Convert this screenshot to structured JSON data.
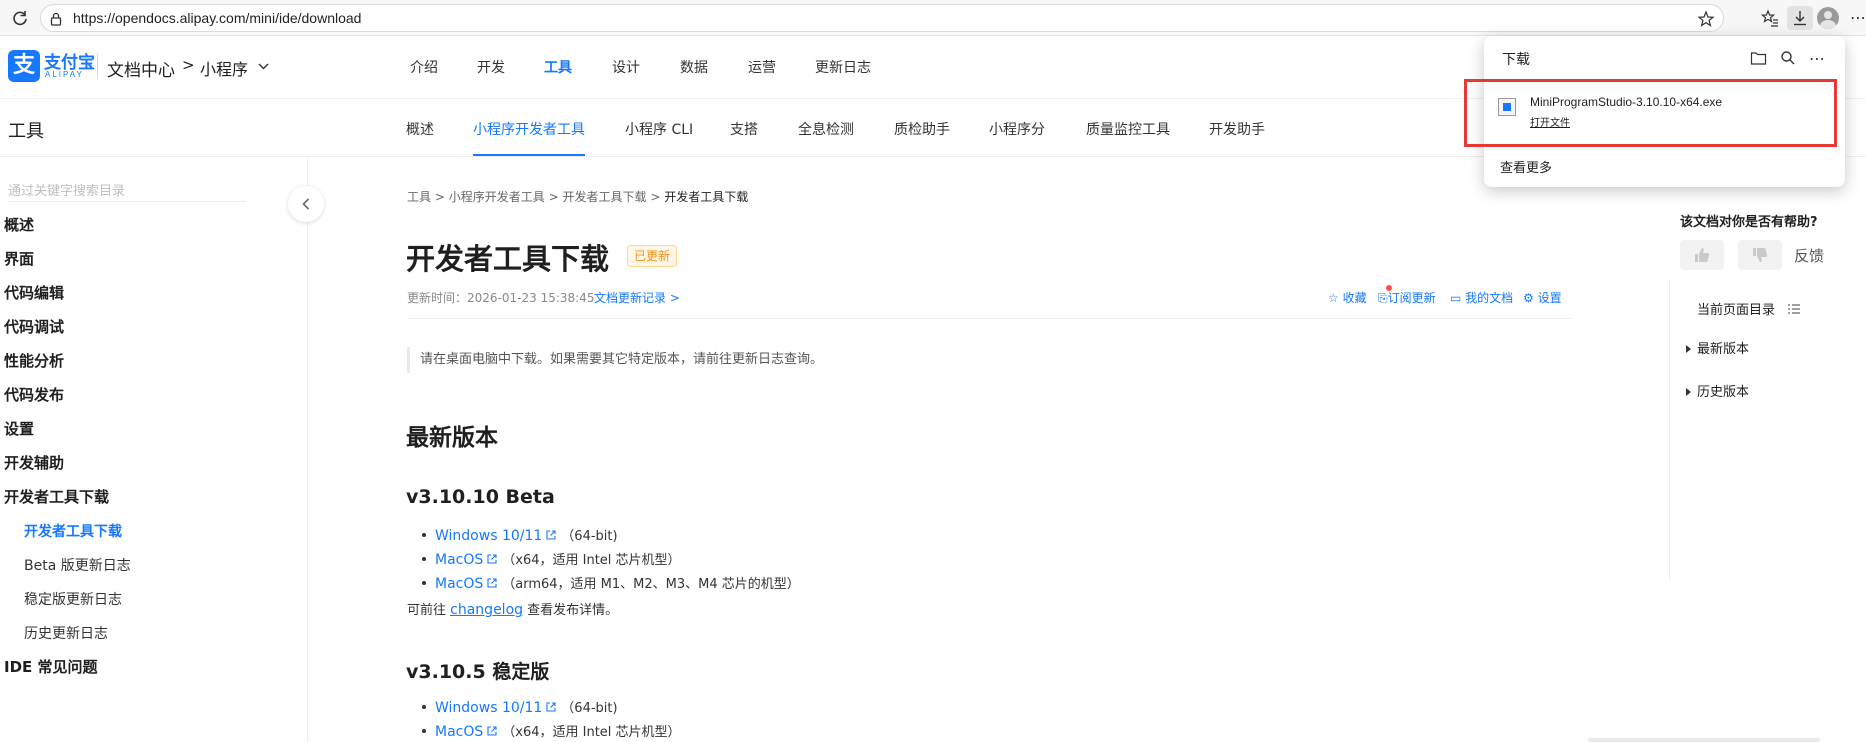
{
  "browser": {
    "url": "https://opendocs.alipay.com/mini/ide/download"
  },
  "header": {
    "logo_text": "支付宝",
    "logo_sub": "ALIPAY",
    "doc_center": "文档中心",
    "separator": ">",
    "product": "小程序",
    "tabs": [
      {
        "label": "介绍"
      },
      {
        "label": "开发"
      },
      {
        "label": "工具",
        "active": true
      },
      {
        "label": "设计"
      },
      {
        "label": "数据"
      },
      {
        "label": "运营"
      },
      {
        "label": "更新日志"
      }
    ]
  },
  "subnav": {
    "title": "工具",
    "tabs": [
      {
        "label": "概述"
      },
      {
        "label": "小程序开发者工具",
        "active": true
      },
      {
        "label": "小程序 CLI"
      },
      {
        "label": "支搭"
      },
      {
        "label": "全息检测"
      },
      {
        "label": "质检助手"
      },
      {
        "label": "小程序分"
      },
      {
        "label": "质量监控工具"
      },
      {
        "label": "开发助手"
      }
    ]
  },
  "sidebar": {
    "search_placeholder": "通过关键字搜索目录",
    "items": [
      {
        "label": "概述"
      },
      {
        "label": "界面"
      },
      {
        "label": "代码编辑"
      },
      {
        "label": "代码调试"
      },
      {
        "label": "性能分析"
      },
      {
        "label": "代码发布"
      },
      {
        "label": "设置"
      },
      {
        "label": "开发辅助"
      },
      {
        "label": "开发者工具下载"
      }
    ],
    "sub_items": [
      {
        "label": "开发者工具下载",
        "active": true
      },
      {
        "label": "Beta 版更新日志"
      },
      {
        "label": "稳定版更新日志"
      },
      {
        "label": "历史更新日志"
      }
    ],
    "last_item": "IDE 常见问题"
  },
  "content": {
    "breadcrumb": [
      "工具",
      "小程序开发者工具",
      "开发者工具下载",
      "开发者工具下载"
    ],
    "breadcrumb_sep": ">",
    "title": "开发者工具下载",
    "badge": "已更新",
    "updated_label": "更新时间：2026-01-23 15:38:45",
    "changelog_link": "文档更新记录 >",
    "actions": {
      "favorite": "收藏",
      "subscribe": "订阅更新",
      "my_docs": "我的文档",
      "settings": "设置"
    },
    "notice": "请在桌面电脑中下载。如果需要其它特定版本，请前往更新日志查询。",
    "latest_heading": "最新版本",
    "beta": {
      "heading": "v3.10.10 Beta",
      "links": [
        {
          "label": "Windows 10/11",
          "note": "（64-bit)"
        },
        {
          "label": "MacOS",
          "note": "（x64，适用 Intel 芯片机型）"
        },
        {
          "label": "MacOS",
          "note": "（arm64，适用 M1、M2、M3、M4 芯片的机型）"
        }
      ],
      "para_prefix": "可前往",
      "para_link": "changelog",
      "para_suffix": "查看发布详情。"
    },
    "stable": {
      "heading": "v3.10.5 稳定版",
      "links": [
        {
          "label": "Windows 10/11",
          "note": "（64-bit)"
        },
        {
          "label": "MacOS",
          "note": "（x64，适用 Intel 芯片机型）"
        }
      ]
    }
  },
  "right_panel": {
    "helpful_question": "该文档对你是否有帮助?",
    "feedback": "反馈",
    "toc_title": "当前页面目录",
    "toc": [
      {
        "label": "最新版本"
      },
      {
        "label": "历史版本"
      }
    ]
  },
  "downloads_popup": {
    "title": "下载",
    "file_name": "MiniProgramStudio-3.10.10-x64.exe",
    "open_file": "打开文件",
    "see_more": "查看更多"
  },
  "colors": {
    "accent": "#1677ff",
    "highlight_box": "#e53935",
    "badge": "#fa8c16"
  }
}
